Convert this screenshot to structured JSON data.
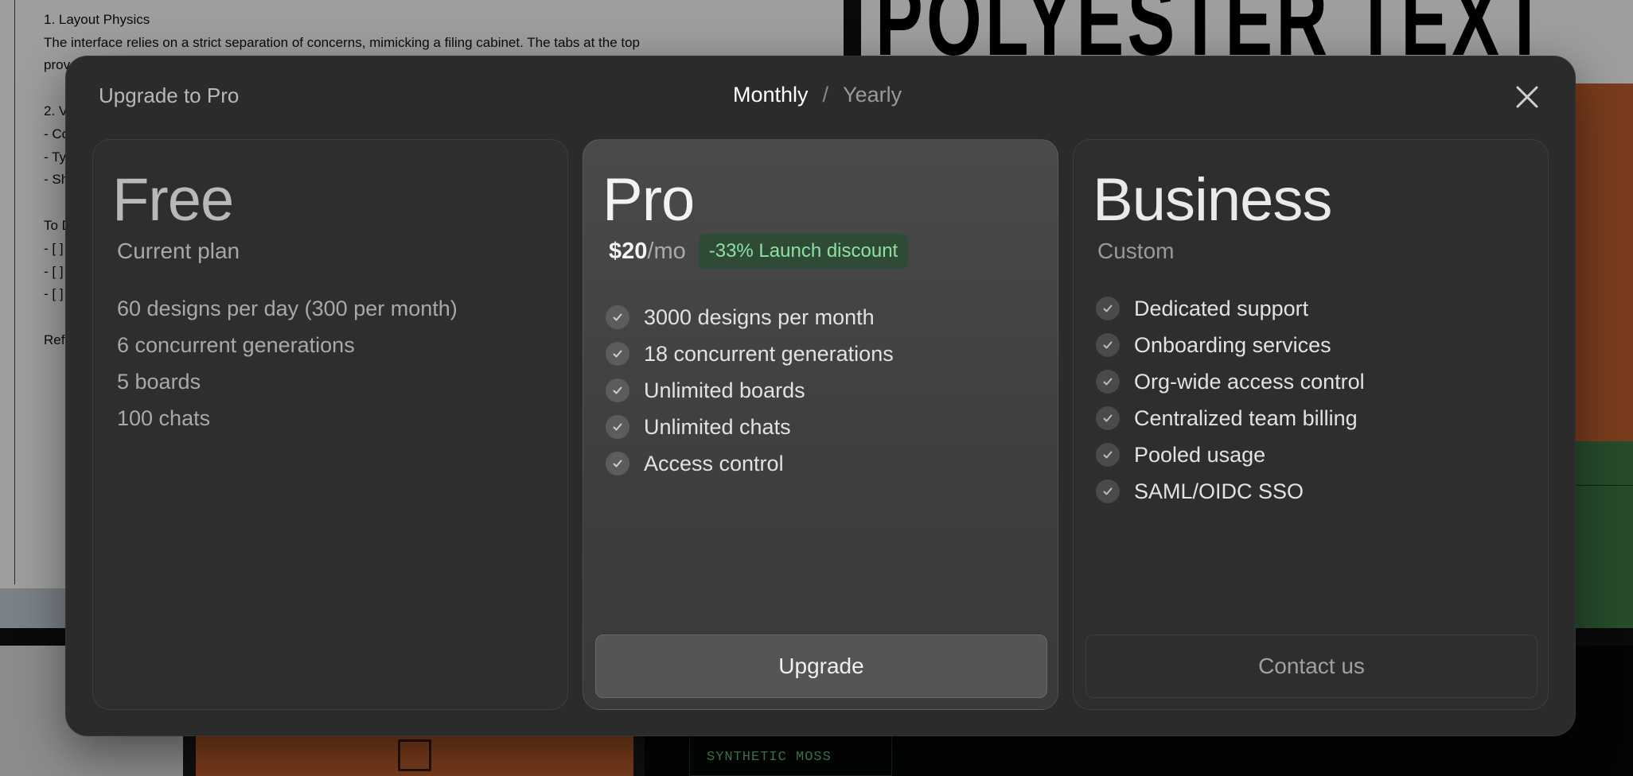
{
  "background": {
    "doc_lines": [
      "1. Layout Physics",
      "The interface relies on a strict separation of concerns, mimicking a filing cabinet. The tabs at the top",
      "prov",
      "",
      "2. V",
      "- Co",
      "- Ty",
      "- Sh",
      "",
      "To D",
      "- [ ]",
      "- [ ]",
      "- [ ]",
      "",
      "Ref"
    ],
    "big_title": "POLYESTER TEXT",
    "moss_label": "SYNTHETIC MOSS"
  },
  "modal": {
    "title": "Upgrade to Pro",
    "billing": {
      "monthly": "Monthly",
      "separator": "/",
      "yearly": "Yearly",
      "selected": "Monthly"
    },
    "close_icon": "close-icon"
  },
  "plans": {
    "free": {
      "name": "Free",
      "subtitle": "Current plan",
      "features": [
        "60 designs per day (300 per month)",
        "6 concurrent generations",
        "5 boards",
        "100 chats"
      ]
    },
    "pro": {
      "name": "Pro",
      "price_amount": "$20",
      "price_period": "/mo",
      "discount": "-33% Launch discount",
      "features": [
        "3000 designs per month",
        "18 concurrent generations",
        "Unlimited boards",
        "Unlimited chats",
        "Access control"
      ],
      "cta": "Upgrade"
    },
    "business": {
      "name": "Business",
      "subtitle": "Custom",
      "features": [
        "Dedicated support",
        "Onboarding services",
        "Org-wide access control",
        "Centralized team billing",
        "Pooled usage",
        "SAML/OIDC SSO"
      ],
      "cta": "Contact us"
    }
  },
  "colors": {
    "modal_bg": "#2b2b2b",
    "pro_card_bg": "#4a4a4a",
    "discount_bg": "#2f4a35",
    "discount_text": "#8fe0a0",
    "check_bg": "#5c5c5c"
  }
}
